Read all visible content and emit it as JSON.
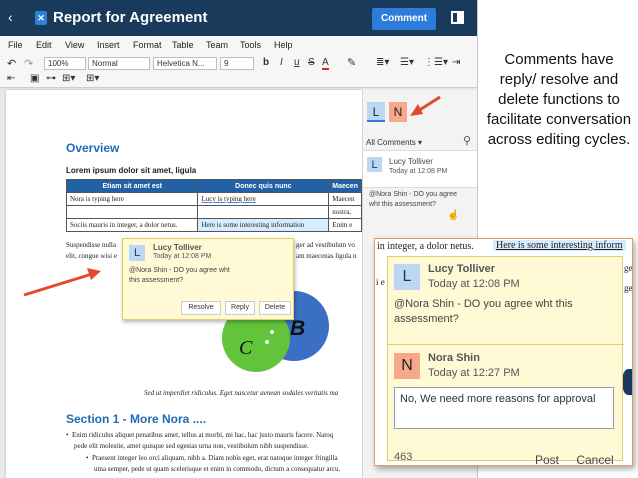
{
  "window": {
    "title": "Report for Agreement",
    "comment_button": "Comment",
    "back_glyph": "‹"
  },
  "menu": [
    "File",
    "Edit",
    "View",
    "Insert",
    "Format",
    "Table",
    "Team",
    "Tools",
    "Help"
  ],
  "toolbar": {
    "zoom": "100%",
    "style": "Normal",
    "font": "Helvetica N...",
    "size": "9",
    "bold": "b",
    "italic": "I",
    "underline": "u",
    "strike": "S",
    "font_color": "A",
    "undo": "↶",
    "redo": "↷"
  },
  "document": {
    "overview_heading": "Overview",
    "lorem_heading": "Lorem ipsum dolor sit amet, ligula",
    "table": {
      "headers": [
        "Etiam sit amet est",
        "Donec quis nunc",
        "Maecen"
      ],
      "rows": [
        [
          "Nora is typing here",
          "Lucy is typing here",
          "Maecen"
        ],
        [
          "",
          "",
          "nostra,"
        ],
        [
          "Sociis mauris in integer, a dolor netus.",
          "Here is some interesting information",
          "Enim e"
        ]
      ]
    },
    "para_lines": [
      "Suspendisse nulla",
      "elit, congue wisi e",
      "ger ad vestibulum vo",
      "am maecenas ligula n"
    ],
    "caption_line": "Sed ut imperdiet ridiculus. Eget nascetur aenean sodales veritatis ma",
    "section_heading": "Section 1 - More Nora ....",
    "bullets": [
      "Enim ridiculus aliquet penatibus amet, tellus at morbi, mi hac, hac justo mauris facere. Natoq",
      "pede elit molestie, amet quisque sed egestas urna non, vestibulum nibh suspendisse.",
      "Praesent integer leo orci aliquam, nibh a. Diam nobis eget, erat natoque integer fringilla",
      "uma semper, pede ut quam scelerisque et enim in commodo, dictum a consequatur arcu."
    ],
    "diagram_labels": [
      "B",
      "C"
    ]
  },
  "popup": {
    "avatar": "L",
    "author": "Lucy Tolliver",
    "time": "Today at 12:08 PM",
    "text": "@Nora Shin - DO you agree wht this assessment?",
    "buttons": [
      "Resolve",
      "Reply",
      "Delete"
    ]
  },
  "panel": {
    "tabs": [
      "L",
      "N"
    ],
    "filter": "All Comments",
    "comment": {
      "avatar": "L",
      "author": "Lucy Tolliver",
      "time": "Today at 12:08 PM",
      "text": "@Nora Shin - DO you agree wht this assessment?"
    }
  },
  "zoom": {
    "strip_left": "in integer, a dolor netus.",
    "strip_right": "Here is some interesting inform",
    "edge_left": "i e",
    "edge_right": [
      "ge",
      "ge"
    ],
    "first": {
      "avatar": "L",
      "author": "Lucy Tolliver",
      "time": "Today at 12:08 PM",
      "text": "@Nora Shin - DO you agree wht this assessment?"
    },
    "reply": {
      "avatar": "N",
      "author": "Nora Shin",
      "time": "Today at 12:27 PM",
      "value": "No, We need more reasons for approval"
    },
    "counter": "463",
    "post": "Post",
    "cancel": "Cancel"
  },
  "caption": "Comments have reply/ resolve and delete functions to facilitate conversation across editing cycles.",
  "colors": {
    "titlebar": "#1a3a5c",
    "accent": "#2d7cd9",
    "comment_bg": "#fff9d6",
    "arrow": "#e24a2b",
    "tab_l": "#bcd7f2",
    "tab_n": "#f5a98a"
  }
}
